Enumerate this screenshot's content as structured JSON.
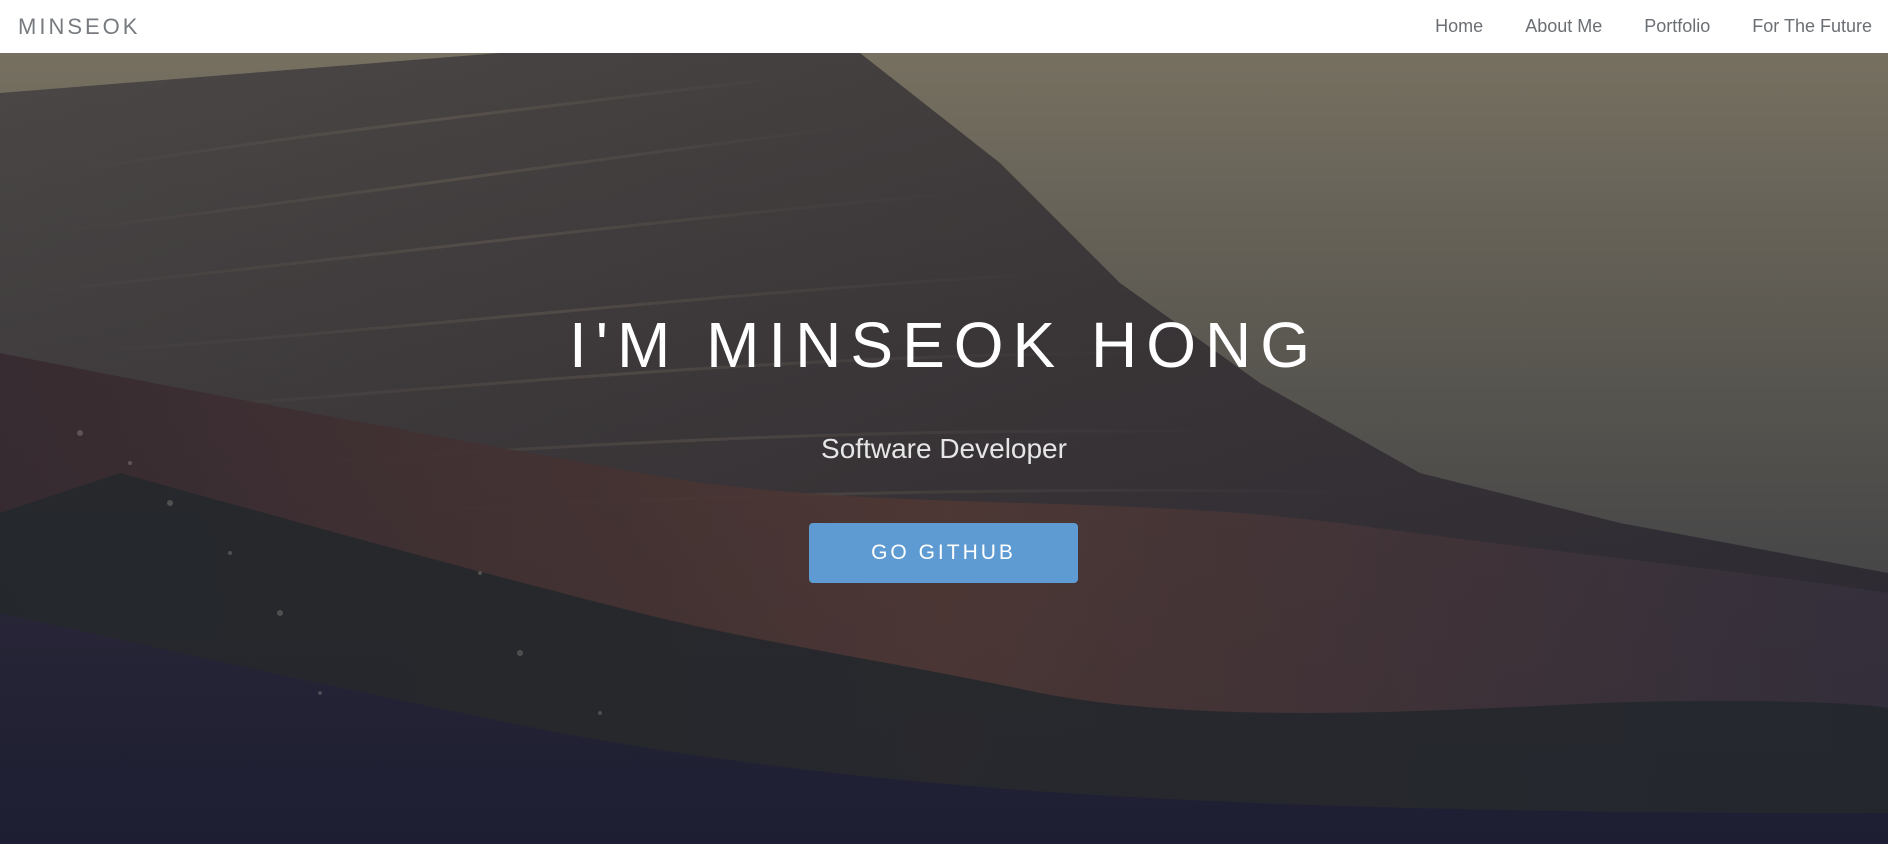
{
  "navbar": {
    "brand": "MINSEOK",
    "links": [
      {
        "label": "Home"
      },
      {
        "label": "About Me"
      },
      {
        "label": "Portfolio"
      },
      {
        "label": "For The Future"
      }
    ]
  },
  "hero": {
    "title": "I'M MINSEOK HONG",
    "subtitle": "Software Developer",
    "cta_label": "GO GITHUB"
  },
  "colors": {
    "accent": "#5f9bd3",
    "nav_text": "#6b6f74",
    "brand_text": "#777b80"
  }
}
